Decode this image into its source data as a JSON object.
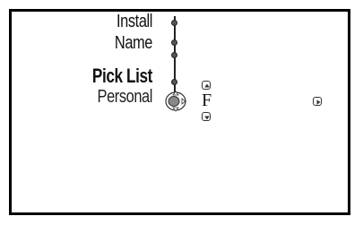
{
  "menu": {
    "items": [
      {
        "label": "Install"
      },
      {
        "label": "Name"
      },
      {
        "label": "Pick List"
      },
      {
        "label": "Personal"
      }
    ],
    "selected_value": "F"
  },
  "icons": {
    "up": "up-arrow-icon",
    "down": "down-arrow-icon",
    "right": "right-arrow-icon",
    "cursor": "cursor-navigation-icon"
  }
}
